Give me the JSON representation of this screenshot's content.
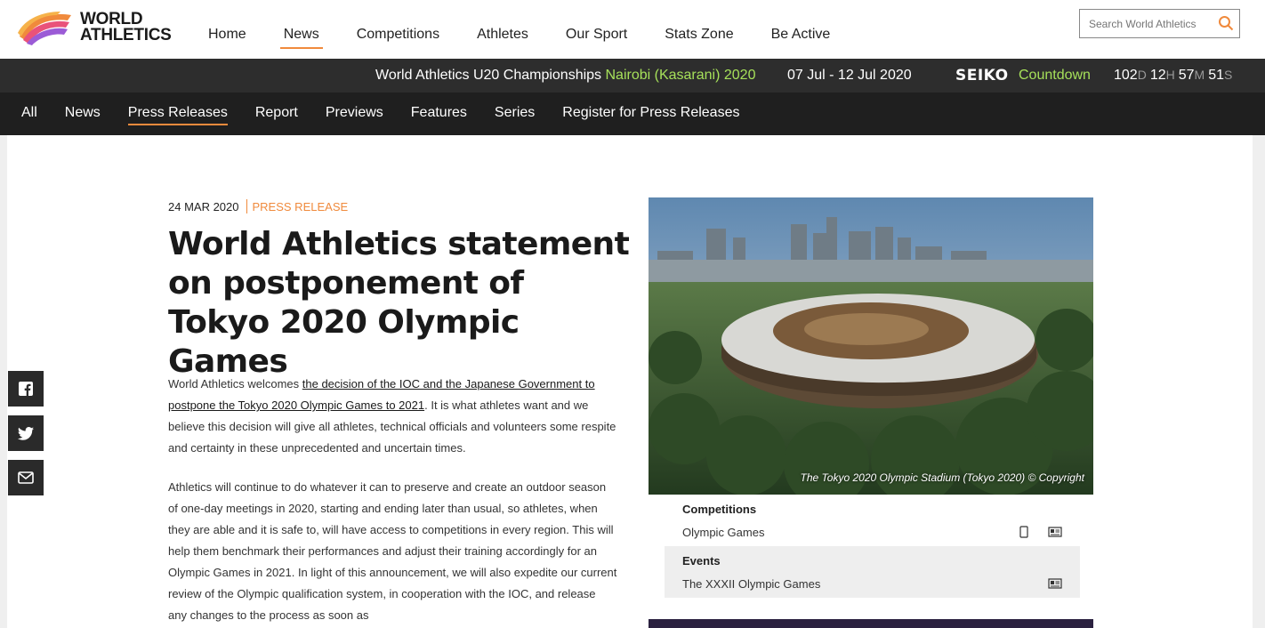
{
  "brand": {
    "logo_text_line1": "WORLD",
    "logo_text_line2": "ATHLETICS",
    "accent": "#f08a3c",
    "highlight": "#a6e05a"
  },
  "main_nav": [
    {
      "label": "Home",
      "active": false
    },
    {
      "label": "News",
      "active": true
    },
    {
      "label": "Competitions",
      "active": false
    },
    {
      "label": "Athletes",
      "active": false
    },
    {
      "label": "Our Sport",
      "active": false
    },
    {
      "label": "Stats Zone",
      "active": false
    },
    {
      "label": "Be Active",
      "active": false
    }
  ],
  "search": {
    "placeholder": "Search World Athletics",
    "icon": "search-icon"
  },
  "championship": {
    "name": "World Athletics U20 Championships",
    "venue": "Nairobi (Kasarani) 2020",
    "dates": "07 Jul - 12 Jul 2020",
    "sponsor": "SEIKO",
    "countdown_label": "Countdown",
    "countdown": {
      "days": "102",
      "days_unit": "D",
      "hours": "12",
      "hours_unit": "H",
      "minutes": "57",
      "minutes_unit": "M",
      "seconds": "51",
      "seconds_unit": "S"
    }
  },
  "sub_nav": [
    {
      "label": "All",
      "active": false
    },
    {
      "label": "News",
      "active": false
    },
    {
      "label": "Press Releases",
      "active": true
    },
    {
      "label": "Report",
      "active": false
    },
    {
      "label": "Previews",
      "active": false
    },
    {
      "label": "Features",
      "active": false
    },
    {
      "label": "Series",
      "active": false
    },
    {
      "label": "Register for Press Releases",
      "active": false
    }
  ],
  "article": {
    "date": "24 MAR 2020",
    "tag": "PRESS RELEASE",
    "headline": "World Athletics statement on postponement of Tokyo 2020 Olympic Games",
    "p1_before": "World Athletics welcomes ",
    "p1_link": "the decision of the IOC and the Japanese Government to postpone the Tokyo 2020 Olympic Games to 2021",
    "p1_after": ". It is what athletes want and we believe this decision will give all athletes, technical officials and volunteers some respite and certainty in these unprecedented and uncertain times.",
    "p2": "Athletics will continue to do whatever it can to preserve and create an outdoor season of one-day meetings in 2020, starting and ending later than usual, so athletes, when they are able and it is safe to, will have access to competitions in every region. This will help them benchmark their performances and adjust their training accordingly for an Olympic Games in 2021. In light of this announcement, we will also expedite our current review of the Olympic qualification system, in cooperation with the IOC, and release any changes to the process as soon as"
  },
  "share": [
    {
      "icon": "facebook-icon"
    },
    {
      "icon": "twitter-icon"
    },
    {
      "icon": "email-icon"
    }
  ],
  "image": {
    "caption": "The Tokyo 2020 Olympic Stadium (Tokyo 2020) © Copyright"
  },
  "related": {
    "competitions_title": "Competitions",
    "competition_item": "Olympic Games",
    "events_title": "Events",
    "event_item": "The XXXII Olympic Games"
  }
}
